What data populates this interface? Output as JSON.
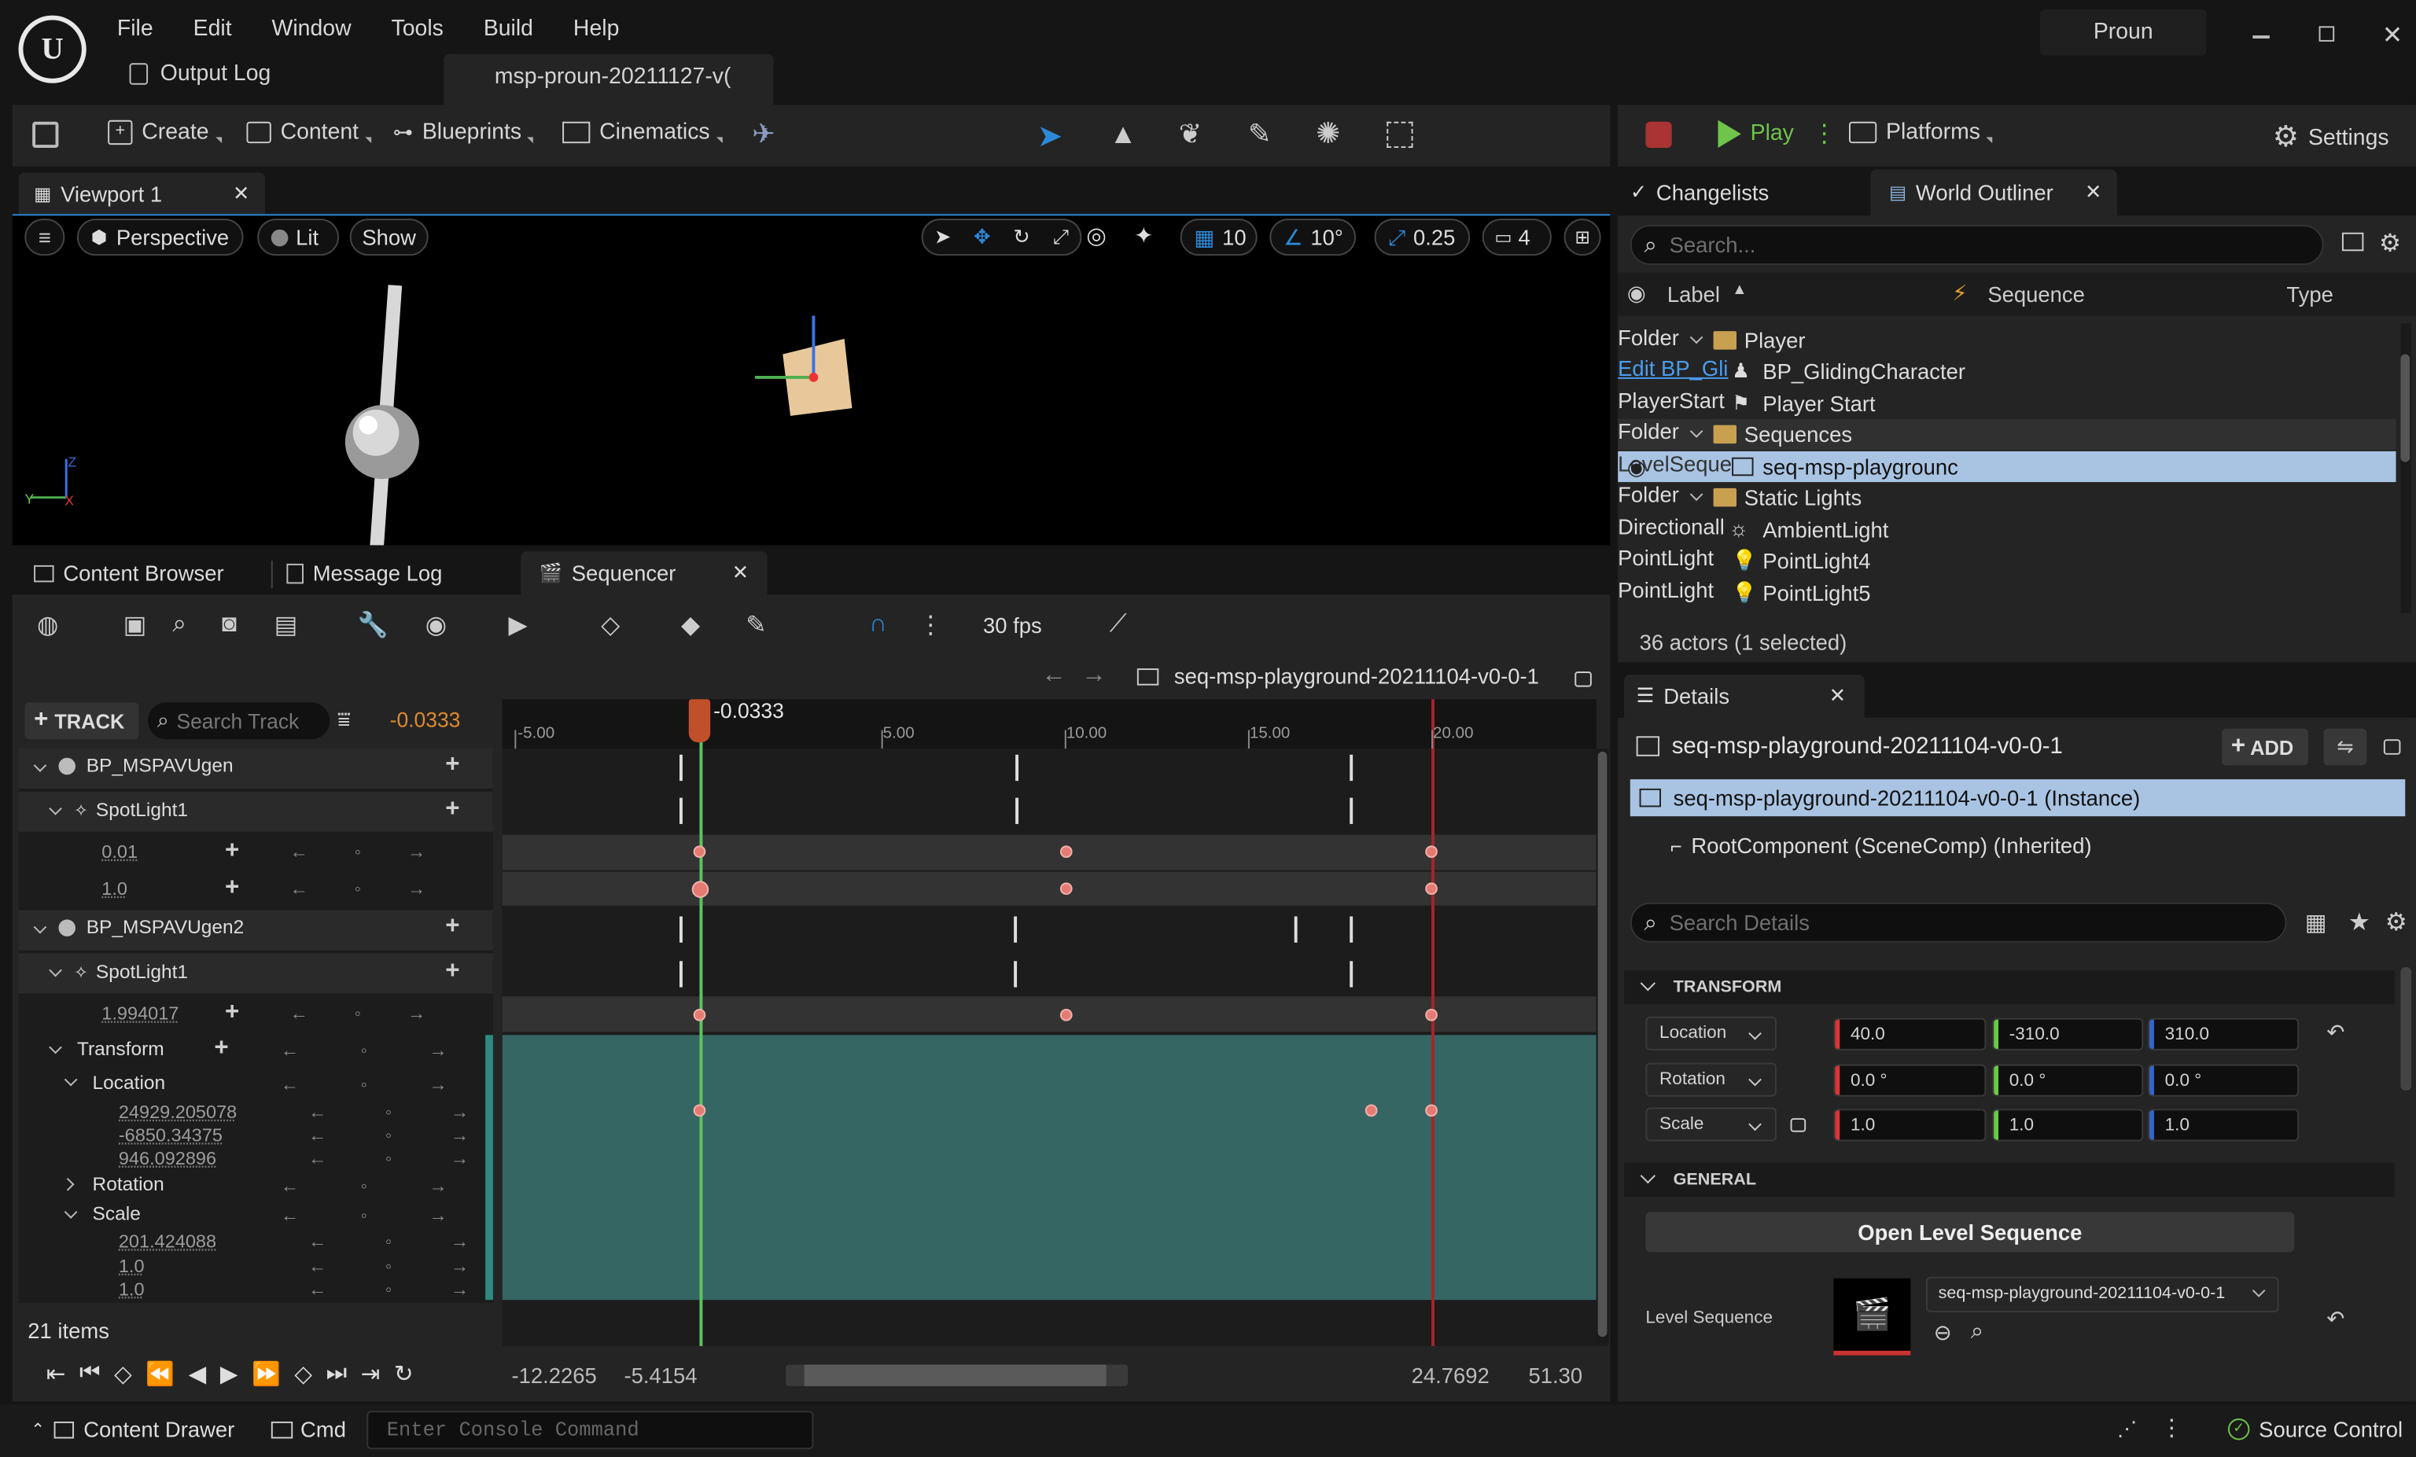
{
  "menu": {
    "items": [
      "File",
      "Edit",
      "Window",
      "Tools",
      "Build",
      "Help"
    ],
    "project_name": "Proun",
    "output_log": "Output Log",
    "level_tab": "msp-proun-20211127-v("
  },
  "toolbar": {
    "create": "Create",
    "content": "Content",
    "blueprints": "Blueprints",
    "cinematics": "Cinematics",
    "play": "Play",
    "platforms": "Platforms",
    "settings": "Settings"
  },
  "viewport": {
    "tab": "Viewport 1",
    "perspective": "Perspective",
    "lit": "Lit",
    "show": "Show",
    "grid": "10",
    "angle": "10°",
    "scale": "0.25",
    "camera": "4"
  },
  "lower_tabs": {
    "content_browser": "Content Browser",
    "message_log": "Message Log",
    "sequencer": "Sequencer"
  },
  "sequencer": {
    "fps": "30 fps",
    "sequence_name": "seq-msp-playground-20211104-v0-0-1",
    "track_button": "TRACK",
    "search_placeholder": "Search Track",
    "current_time": "-0.0333",
    "playhead_label": "-0.0333",
    "ruler": [
      "-5.00",
      "5.00",
      "10.00",
      "15.00",
      "20.00"
    ],
    "tracks": {
      "actor1": "BP_MSPAVUgen",
      "light1": "SpotLight1",
      "val1": "0.01",
      "val2": "1.0",
      "actor2": "BP_MSPAVUgen2",
      "light2": "SpotLight1",
      "val3": "1.994017",
      "transform": "Transform",
      "location": "Location",
      "loc_x": "24929.205078",
      "loc_y": "-6850.34375",
      "loc_z": "946.092896",
      "rotation": "Rotation",
      "scale": "Scale",
      "scale_x": "201.424088",
      "scale_y": "1.0",
      "scale_z": "1.0"
    },
    "items_count": "21 items",
    "range_start": "-12.2265",
    "view_start": "-5.4154",
    "view_end": "24.7692",
    "range_end": "51.30"
  },
  "outliner": {
    "changelists": "Changelists",
    "tab": "World Outliner",
    "search_placeholder": "Search...",
    "col_label": "Label",
    "col_sequence": "Sequence",
    "col_type": "Type",
    "rows": [
      {
        "label": "Player",
        "type": "Folder",
        "kind": "folder"
      },
      {
        "label": "BP_GlidingCharacter",
        "type": "Edit BP_Gli",
        "kind": "actor"
      },
      {
        "label": "Player Start",
        "type": "PlayerStart",
        "kind": "actor"
      },
      {
        "label": "Sequences",
        "type": "Folder",
        "kind": "folder"
      },
      {
        "label": "seq-msp-playgrounc",
        "type": "LevelSeque",
        "kind": "actor"
      },
      {
        "label": "Static Lights",
        "type": "Folder",
        "kind": "folder"
      },
      {
        "label": "AmbientLight",
        "type": "Directionall",
        "kind": "actor"
      },
      {
        "label": "PointLight4",
        "type": "PointLight",
        "kind": "actor"
      },
      {
        "label": "PointLight5",
        "type": "PointLight",
        "kind": "actor"
      }
    ],
    "status": "36 actors (1 selected)"
  },
  "details": {
    "tab": "Details",
    "title": "seq-msp-playground-20211104-v0-0-1",
    "add": "ADD",
    "instance": "seq-msp-playground-20211104-v0-0-1 (Instance)",
    "root": "RootComponent (SceneComp) (Inherited)",
    "search_placeholder": "Search Details",
    "transform_section": "TRANSFORM",
    "location_label": "Location",
    "rotation_label": "Rotation",
    "scale_label": "Scale",
    "location": [
      "40.0",
      "-310.0",
      "310.0"
    ],
    "rotation": [
      "0.0 °",
      "0.0 °",
      "0.0 °"
    ],
    "scale": [
      "1.0",
      "1.0",
      "1.0"
    ],
    "general_section": "GENERAL",
    "open_level_sequence": "Open Level Sequence",
    "level_sequence_label": "Level Sequence",
    "level_sequence_value": "seq-msp-playground-20211104-v0-0-1"
  },
  "statusbar": {
    "content_drawer": "Content Drawer",
    "cmd": "Cmd",
    "console_placeholder": "Enter Console Command",
    "source_control": "Source Control"
  },
  "colors": {
    "accent_blue": "#2c89d9",
    "play_green": "#6fc44a",
    "key_red": "#e47b73",
    "selected_row": "#1b75c4",
    "x_red": "#d33",
    "y_green": "#6c4",
    "z_blue": "#36c"
  }
}
